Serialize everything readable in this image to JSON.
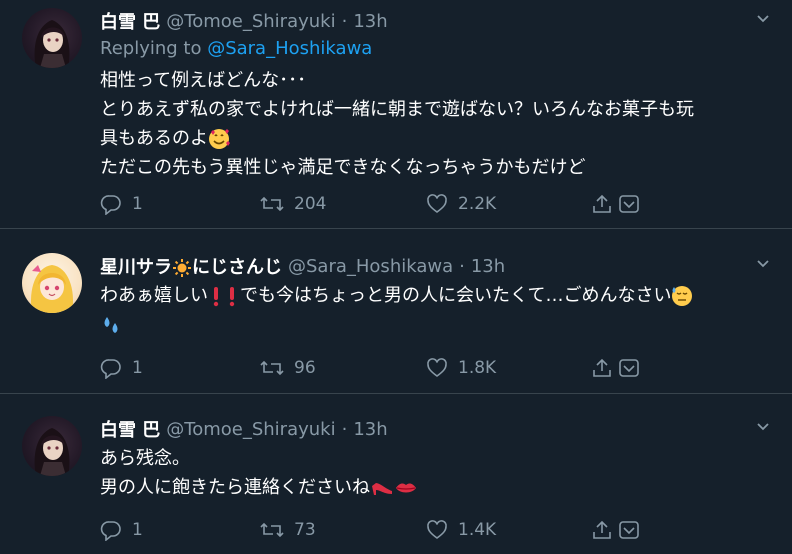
{
  "tweets": [
    {
      "display_name": "白雪 巴",
      "handle": "@Tomoe_Shirayuki",
      "dot": "·",
      "time": "13h",
      "replying_prefix": "Replying to ",
      "replying_handle": "@Sara_Hoshikawa",
      "lines": [
        "相性って例えばどんな･･･",
        "とりあえず私の家でよければ一緒に朝まで遊ばない？いろんなお菓子も玩",
        "具もあるのよ",
        "ただこの先もう異性じゃ満足できなくなっちゃうかもだけど"
      ],
      "replies": "1",
      "retweets": "204",
      "likes": "2.2K"
    },
    {
      "display_name_a": "星川サラ",
      "display_name_b": "にじさんじ",
      "handle": "@Sara_Hoshikawa",
      "dot": "·",
      "time": "13h",
      "lines": [
        "わあぁ嬉しい",
        "でも今はちょっと男の人に会いたくて…ごめんなさい"
      ],
      "replies": "1",
      "retweets": "96",
      "likes": "1.8K"
    },
    {
      "display_name": "白雪 巴",
      "handle": "@Tomoe_Shirayuki",
      "dot": "·",
      "time": "13h",
      "lines": [
        "あら残念。",
        "男の人に飽きたら連絡くださいね"
      ],
      "replies": "1",
      "retweets": "73",
      "likes": "1.4K"
    }
  ],
  "icons": [
    "reply-icon",
    "retweet-icon",
    "like-icon",
    "share-icon",
    "bookmark-icon",
    "more-caret-icon"
  ],
  "colors": {
    "background": "#15202b",
    "muted": "#8899a6",
    "link": "#1da1f2",
    "divider": "#38444d"
  }
}
